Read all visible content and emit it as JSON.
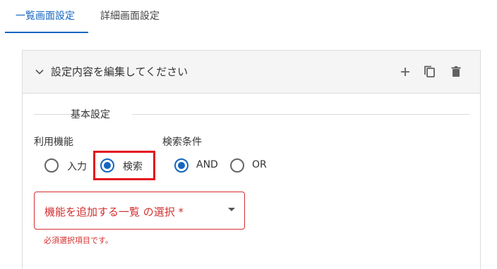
{
  "tabs": [
    {
      "label": "一覧画面設定",
      "active": true
    },
    {
      "label": "詳細画面設定",
      "active": false
    }
  ],
  "panel": {
    "title": "設定内容を編集してください",
    "icons": [
      "chevron-down-icon",
      "plus-icon",
      "copy-icon",
      "trash-icon"
    ]
  },
  "section": {
    "title": "基本設定"
  },
  "usage": {
    "label": "利用機能",
    "options": [
      {
        "label": "入力",
        "checked": false
      },
      {
        "label": "検索",
        "checked": true
      }
    ]
  },
  "search_condition": {
    "label": "検索条件",
    "options": [
      {
        "label": "AND",
        "checked": true
      },
      {
        "label": "OR",
        "checked": false
      }
    ]
  },
  "select": {
    "label": "機能を追加する一覧 の選択 *",
    "helper": "必須選択項目です。"
  },
  "colors": {
    "accent": "#1565c0",
    "error": "#d32f2f",
    "highlight": "#e3141f"
  }
}
